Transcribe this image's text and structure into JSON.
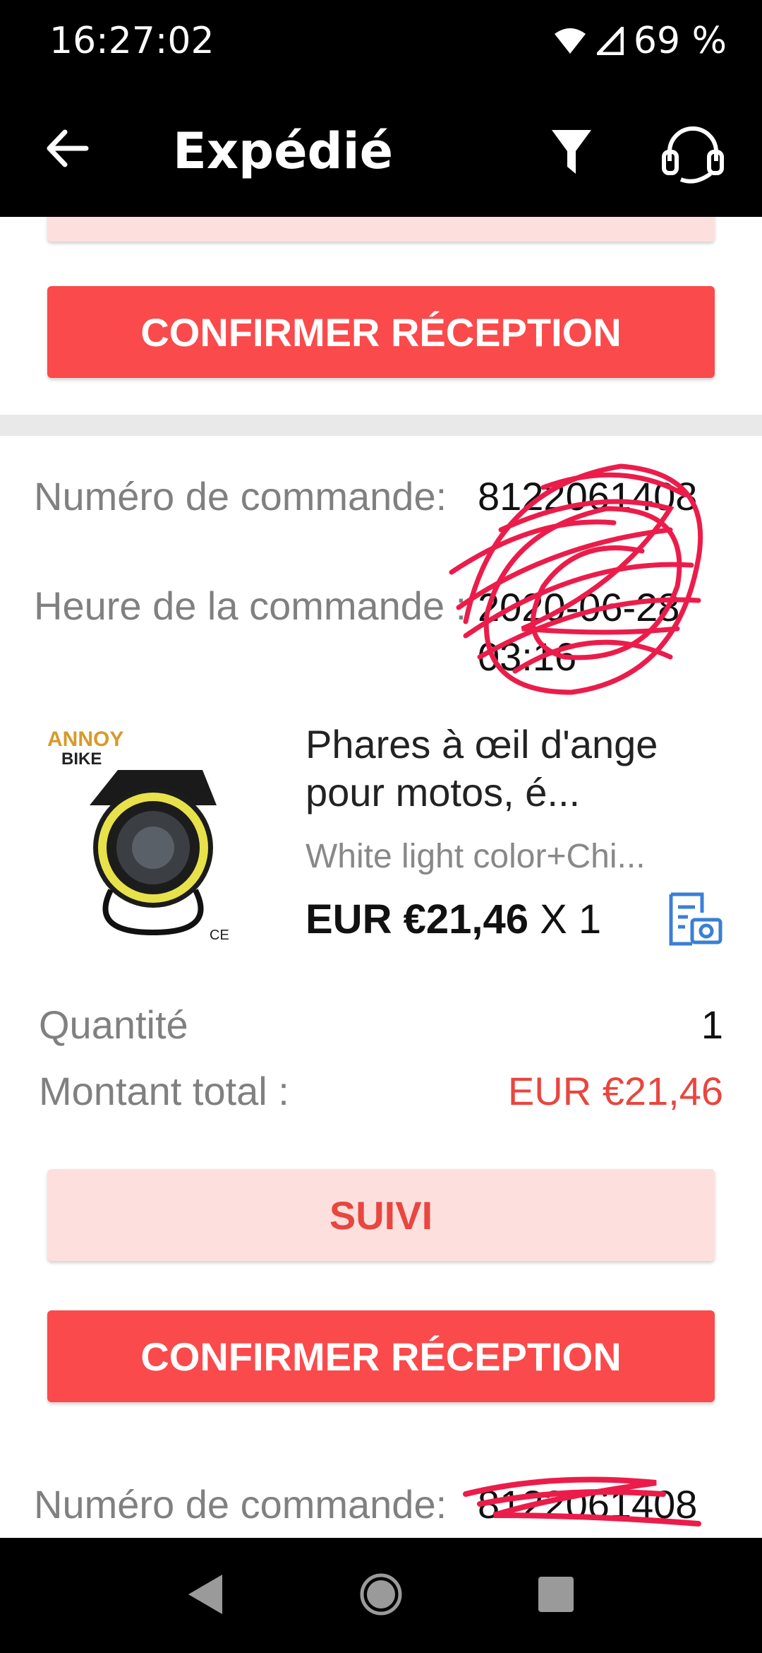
{
  "status": {
    "time": "16:27:02",
    "battery": "69 %"
  },
  "appbar": {
    "title": "Expédié",
    "icons": [
      "back-arrow-icon",
      "filter-icon",
      "headset-support-icon"
    ]
  },
  "buttons": {
    "confirm": "CONFIRMER RÉCEPTION",
    "track": "SUIVI"
  },
  "order": {
    "number_label": "Numéro de commande:",
    "number_value": "8122061408",
    "time_label": "Heure de la commande :",
    "time_value": "2020-06-28 03:16",
    "product": {
      "name": "Phares à œil d'ange pour motos, é...",
      "variant": "White light color+Chi...",
      "price": "EUR €21,46",
      "qty_text": "X 1",
      "brand": "ANNOY BIKE",
      "cert": "CE"
    },
    "quantity_label": "Quantité",
    "quantity_value": "1",
    "total_label": "Montant total :",
    "total_value": "EUR €21,46"
  },
  "next_order": {
    "number_label": "Numéro de commande:",
    "number_value": "8122061408"
  },
  "colors": {
    "primary": "#fa4a4b",
    "light": "#fde0de",
    "total": "#e8463f"
  }
}
